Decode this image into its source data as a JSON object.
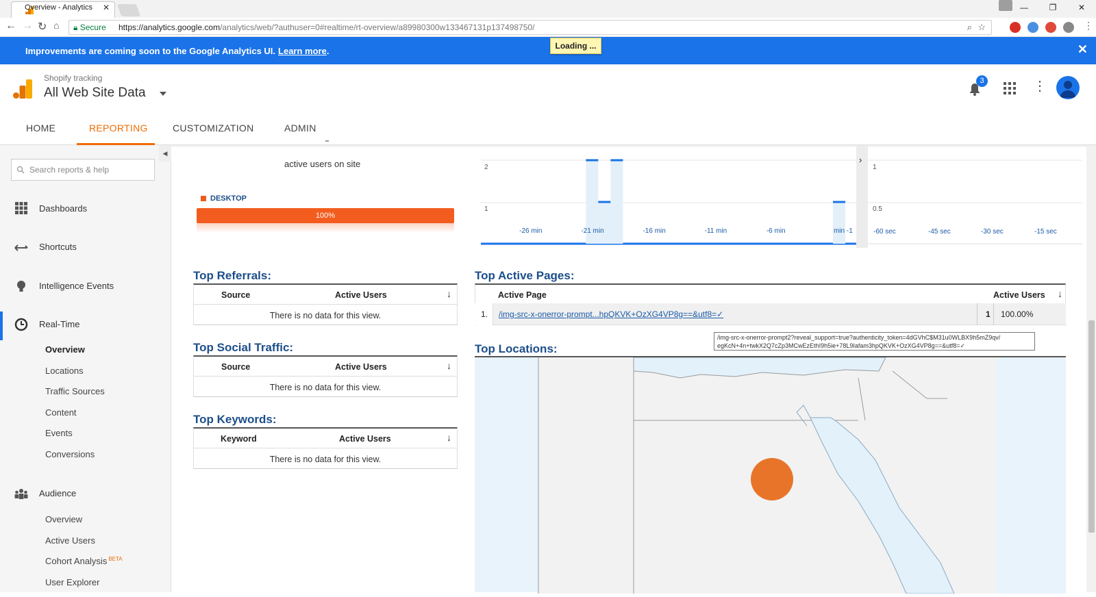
{
  "browser": {
    "tab_title": "Overview - Analytics",
    "tab_close": "✕",
    "secure_label": "Secure",
    "url_base": "https://analytics.google.com",
    "url_path": "/analytics/web/?authuser=0#realtime/rt-overview/a89980300w133467131p137498750/",
    "window_controls": [
      "—",
      "❐",
      "✕"
    ]
  },
  "banner": {
    "text": "Improvements are coming soon to the Google Analytics UI.",
    "link": "Learn more",
    "after": ".",
    "close": "✕"
  },
  "loading": "Loading ...",
  "header": {
    "account": "Shopify tracking",
    "view": "All Web Site Data",
    "notifications_count": "3"
  },
  "nav": {
    "tabs": [
      "HOME",
      "REPORTING",
      "CUSTOMIZATION",
      "ADMIN"
    ]
  },
  "sidebar": {
    "search_placeholder": "Search reports & help",
    "sections": {
      "dashboards": "Dashboards",
      "shortcuts": "Shortcuts",
      "intelligence": "Intelligence Events",
      "realtime": "Real-Time",
      "audience": "Audience"
    },
    "realtime_items": [
      "Overview",
      "Locations",
      "Traffic Sources",
      "Content",
      "Events",
      "Conversions"
    ],
    "audience_items": [
      "Overview",
      "Active Users",
      "Cohort Analysis",
      "User Explorer"
    ],
    "beta": "BETA"
  },
  "main": {
    "active_users_label": "active users on site",
    "device": {
      "label": "DESKTOP",
      "percent": "100%"
    },
    "referrals": {
      "title": "Top Referrals:",
      "col1": "Source",
      "col2": "Active Users",
      "empty": "There is no data for this view."
    },
    "social": {
      "title": "Top Social Traffic:",
      "col1": "Source",
      "col2": "Active Users",
      "empty": "There is no data for this view."
    },
    "keywords": {
      "title": "Top Keywords:",
      "col1": "Keyword",
      "col2": "Active Users",
      "empty": "There is no data for this view."
    },
    "active_pages": {
      "title": "Top Active Pages:",
      "col1": "Active Page",
      "col2": "Active Users",
      "row_index": "1.",
      "row_page": "/img-src-x-onerror-prompt...hpQKVK+OzXG4VP8g==&utf8=✓",
      "row_users": "1",
      "row_percent": "100.00%"
    },
    "tooltip_line1": "/img-src-x-onerror-prompt2?reveal_support=true?authenticity_token=4dGVhC$M31u0WLBX9h5mZ9qv/",
    "tooltip_line2": "egKcN+4n+twkX2Q7cZp3MCwEzEthI9h5ie+78L9Iafam3hpQKVK+OzXG4VP8g==&utf8=✓",
    "locations_title": "Top Locations:"
  },
  "chart_data": [
    {
      "type": "bar",
      "title": "",
      "x_tick_labels": [
        "-26 min",
        "-21 min",
        "-16 min",
        "-11 min",
        "-6 min",
        "min -1"
      ],
      "y_tick_labels": [
        "2",
        "1"
      ],
      "ylim": [
        0,
        2
      ],
      "x": [
        -21,
        -20,
        -19,
        -1
      ],
      "values": [
        2,
        1,
        2,
        1
      ],
      "xlim": [
        -30,
        -0.5
      ]
    },
    {
      "type": "bar",
      "title": "",
      "x_tick_labels": [
        "-60 sec",
        "-45 sec",
        "-30 sec",
        "-15 sec"
      ],
      "y_tick_labels": [
        "1",
        "0.5"
      ],
      "ylim": [
        0,
        1
      ],
      "values": []
    }
  ],
  "colors": {
    "accent": "#ef6c00",
    "brand_blue": "#1a73e8",
    "device_bar": "#f25d1f",
    "map_dot": "#e8742a"
  }
}
